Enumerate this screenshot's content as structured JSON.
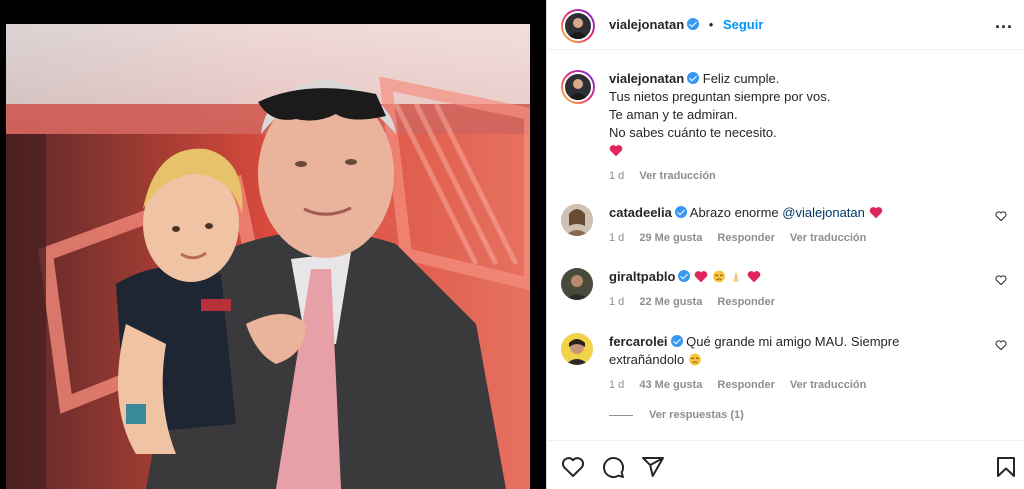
{
  "post": {
    "author": "vialejonatan",
    "follow_label": "Seguir",
    "separator": "•",
    "more": "..."
  },
  "caption": {
    "username": "vialejonatan",
    "lines": [
      "Feliz cumple.",
      "Tus nietos preguntan siempre por vos.",
      "Te aman y te admiran.",
      "No sabes cuánto te necesito."
    ],
    "time": "1 d",
    "translate": "Ver traducción"
  },
  "comments": [
    {
      "username": "catadeelia",
      "text": "Abrazo enorme",
      "mention": "@vialejonatan",
      "time": "1 d",
      "likes": "29 Me gusta",
      "reply": "Responder",
      "translate": "Ver traducción"
    },
    {
      "username": "giraltpablo",
      "text": "",
      "time": "1 d",
      "likes": "22 Me gusta",
      "reply": "Responder"
    },
    {
      "username": "fercarolei",
      "text_line1": "Qué grande mi amigo MAU. Siempre",
      "text_line2": "extrañándolo",
      "time": "1 d",
      "likes": "43 Me gusta",
      "reply": "Responder",
      "translate": "Ver traducción"
    }
  ],
  "view_replies": "Ver respuestas (1)",
  "icons": {
    "like": "heart-icon",
    "comment": "comment-icon",
    "share": "share-icon",
    "save": "bookmark-icon",
    "more": "more-icon"
  },
  "colors": {
    "accent": "#0095f6",
    "verified": "#3897f0",
    "heart": "#ed4956",
    "muted": "#8e8e8e"
  }
}
